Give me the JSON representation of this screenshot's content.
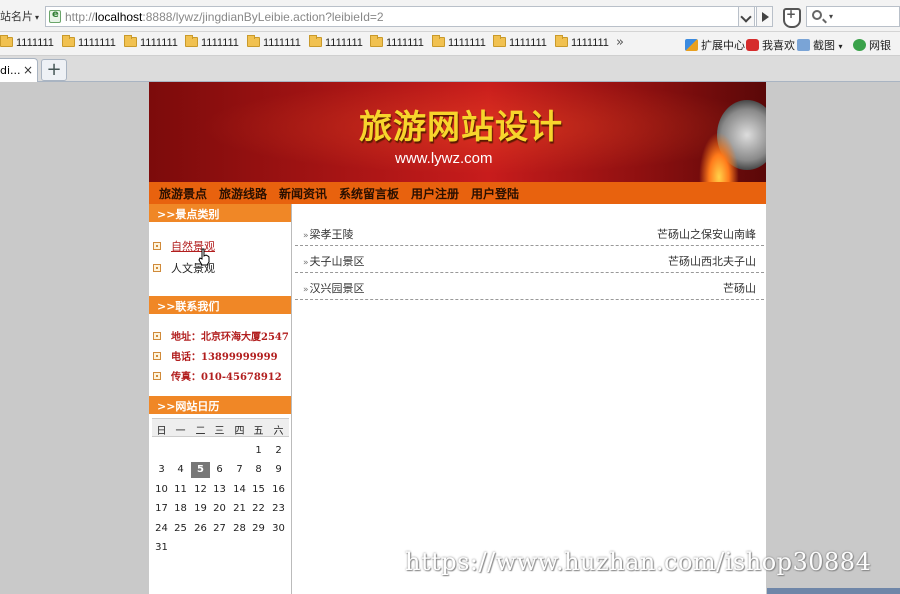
{
  "browser": {
    "site_name_label": "站名片",
    "url_prefix": "http://",
    "url_host": "localhost",
    "url_rest": ":8888/lywz/jingdianByLeibie.action?leibieId=2",
    "favorites": [
      "1111111",
      "1111111",
      "1111111",
      "1111111",
      "1111111",
      "1111111",
      "1111111",
      "1111111",
      "1111111",
      "1111111"
    ],
    "favorites_more": "»",
    "tools": {
      "extensions": "扩展中心",
      "favorite": "我喜欢",
      "screenshot": "截图",
      "netbank": "网银"
    },
    "tab_label": "di...",
    "tab_close": "×",
    "new_tab": "+"
  },
  "site": {
    "banner_title": "旅游网站设计",
    "banner_url": "www.lywz.com",
    "nav": [
      "旅游景点",
      "旅游线路",
      "新闻资讯",
      "系统留言板",
      "用户注册",
      "用户登陆"
    ],
    "categories_title": ">>景点类别",
    "categories": [
      {
        "label": "自然景观",
        "active": true
      },
      {
        "label": "人文景观",
        "active": false
      }
    ],
    "contact_title": ">>联系我们",
    "contact": {
      "address": "地址：北京环海大厦2547",
      "phone": "电话：13899999999",
      "fax": "传真：010-45678912"
    },
    "calendar_title": ">>网站日历",
    "calendar": {
      "weekdays": [
        "日",
        "一",
        "二",
        "三",
        "四",
        "五",
        "六"
      ],
      "weeks": [
        [
          "",
          "",
          "",
          "",
          "",
          "1",
          "2"
        ],
        [
          "3",
          "4",
          "5",
          "6",
          "7",
          "8",
          "9"
        ],
        [
          "10",
          "11",
          "12",
          "13",
          "14",
          "15",
          "16"
        ],
        [
          "17",
          "18",
          "19",
          "20",
          "21",
          "22",
          "23"
        ],
        [
          "24",
          "25",
          "26",
          "27",
          "28",
          "29",
          "30"
        ],
        [
          "31",
          "",
          "",
          "",
          "",
          "",
          ""
        ]
      ],
      "today": "5"
    },
    "spots": [
      {
        "name": "梁孝王陵",
        "location": "芒砀山之保安山南峰"
      },
      {
        "name": "夫子山景区",
        "location": "芒砀山西北夫子山"
      },
      {
        "name": "汉兴园景区",
        "location": "芒砀山"
      }
    ],
    "row_marker": "»"
  },
  "watermark": "https://www.huzhan.com/ishop30884"
}
